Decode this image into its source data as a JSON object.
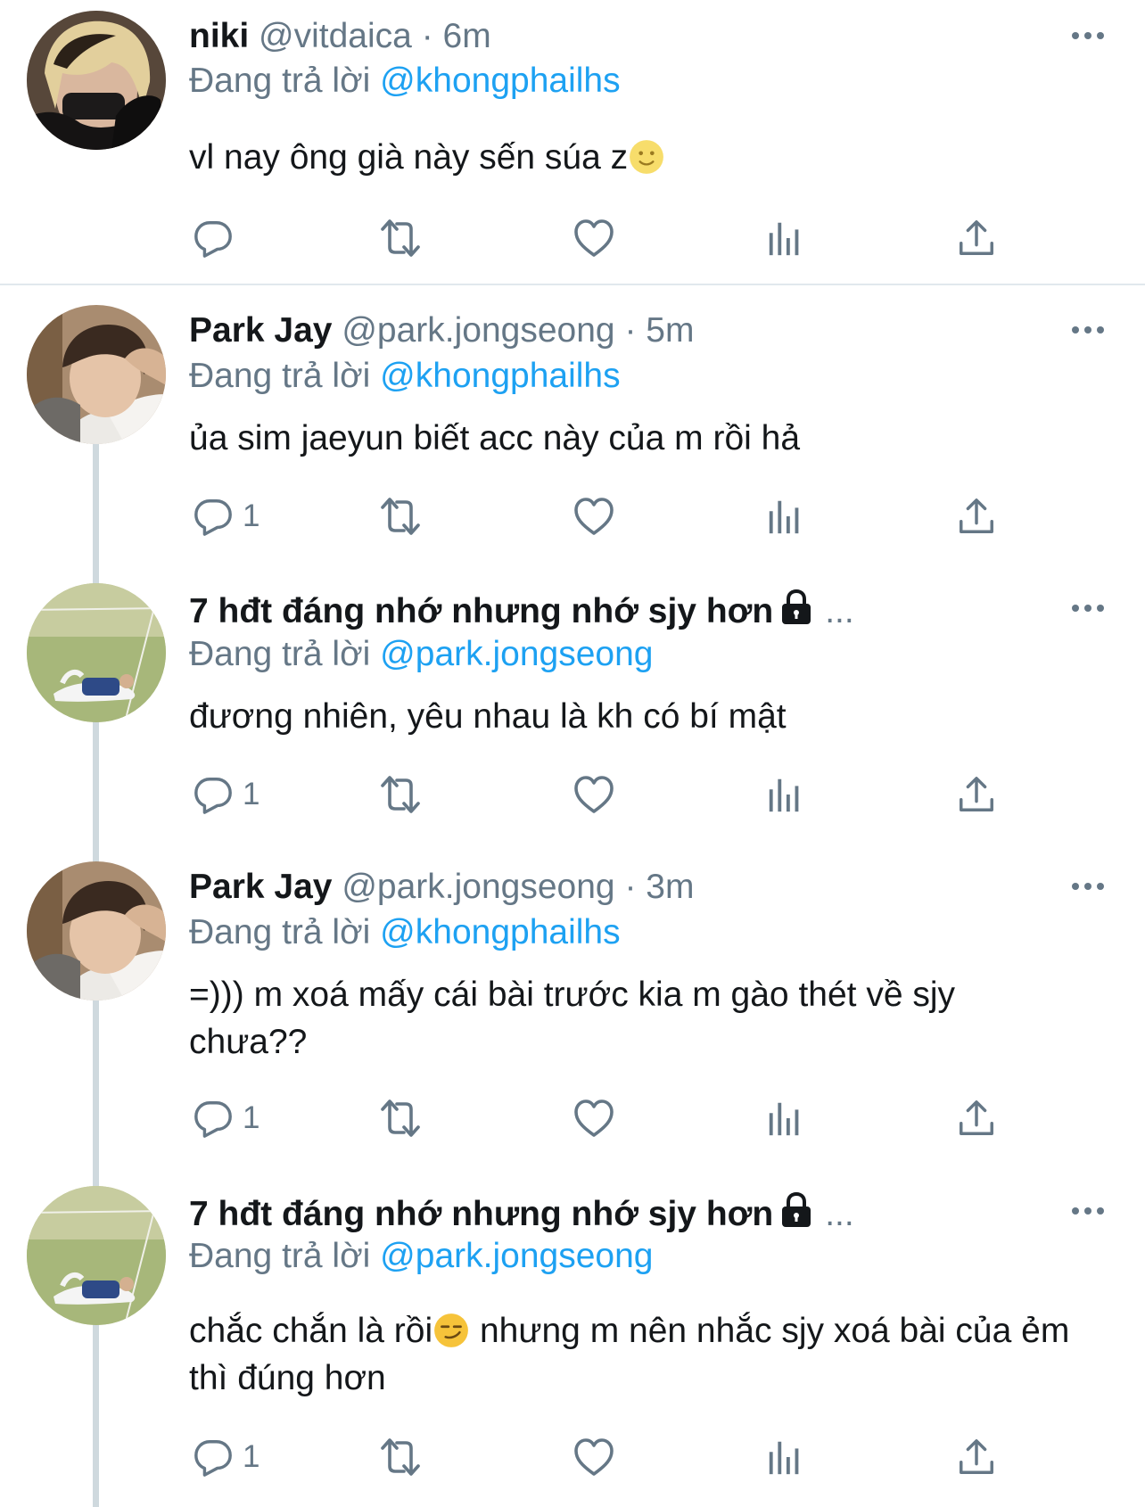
{
  "replying_prefix": "Đang trả lời",
  "tweets": [
    {
      "name": "niki",
      "handle": "@vitdaica",
      "time": "· 6m",
      "reply_to": "@khongphailhs",
      "text": "vl nay ông già này sến súa z",
      "emoji": "slightly-smiling-face",
      "reply_count": ""
    },
    {
      "name": "Park Jay",
      "handle": "@park.jongseong",
      "time": "· 5m",
      "reply_to": "@khongphailhs",
      "text": "ủa sim jaeyun biết acc này của m rồi hả",
      "reply_count": "1"
    },
    {
      "name": "7 hđt đáng nhớ nhưng nhớ sjy hơn",
      "ellipsis": "...",
      "protected": true,
      "reply_to": "@park.jongseong",
      "text": "đương nhiên, yêu nhau là kh có bí mật",
      "reply_count": "1"
    },
    {
      "name": "Park Jay",
      "handle": "@park.jongseong",
      "time": "· 3m",
      "reply_to": "@khongphailhs",
      "text": "=))) m xoá mấy cái bài trước kia m gào thét về sjy chưa??",
      "reply_count": "1"
    },
    {
      "name": "7 hđt đáng nhớ nhưng nhớ sjy hơn",
      "ellipsis": "...",
      "protected": true,
      "reply_to": "@park.jongseong",
      "text_a": "chắc chắn là rồi",
      "text_b": " nhưng m nên nhắc sjy xoá bài của ẻm thì đúng hơn",
      "emoji": "smirking-face",
      "reply_count": "1"
    }
  ],
  "icons": [
    "reply-icon",
    "retweet-icon",
    "like-icon",
    "analytics-icon",
    "share-icon",
    "more-icon",
    "lock-icon"
  ],
  "colors": {
    "link": "#1da1f2",
    "secondary": "#657786",
    "thread_line": "#cfd9de"
  }
}
